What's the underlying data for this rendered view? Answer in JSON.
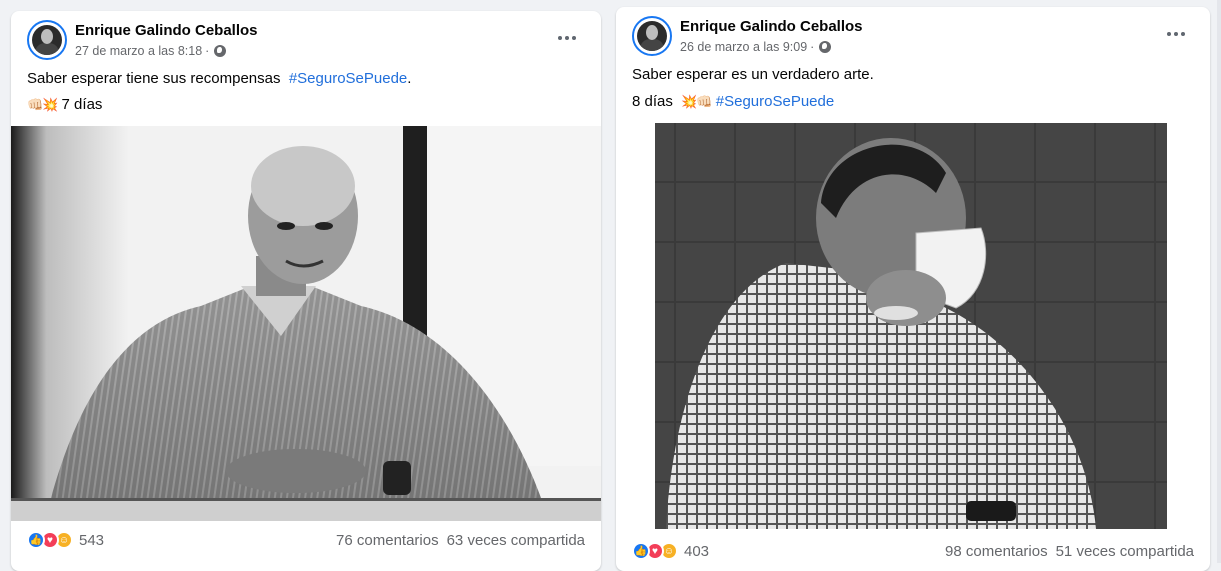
{
  "posts": [
    {
      "author": "Enrique Galindo Ceballos",
      "timestamp": "27 de marzo a las 8:18",
      "text_prefix": "Saber esperar tiene sus recompensas",
      "hashtag": "#SeguroSePuede",
      "text_suffix": ".",
      "line2_emoji": "👊🏻💥",
      "line2_text": "7 días",
      "reaction_count": "543",
      "comments": "76 comentarios",
      "shares": "63 veces compartida"
    },
    {
      "author": "Enrique Galindo Ceballos",
      "timestamp": "26 de marzo a las 9:09",
      "text": "Saber esperar es un verdadero arte.",
      "line2_text": "8 días",
      "line2_emoji": "💥👊🏻",
      "hashtag": "#SeguroSePuede",
      "reaction_count": "403",
      "comments": "98 comentarios",
      "shares": "51 veces compartida"
    }
  ],
  "icons": {
    "privacy": "globe-icon",
    "more": "more-options-icon",
    "reactions": [
      "like-icon",
      "love-icon",
      "care-icon"
    ]
  },
  "colors": {
    "link": "#216fdb",
    "secondary_text": "#65676b",
    "like": "#1877f2",
    "love": "#f33e58",
    "care": "#f7b125"
  }
}
